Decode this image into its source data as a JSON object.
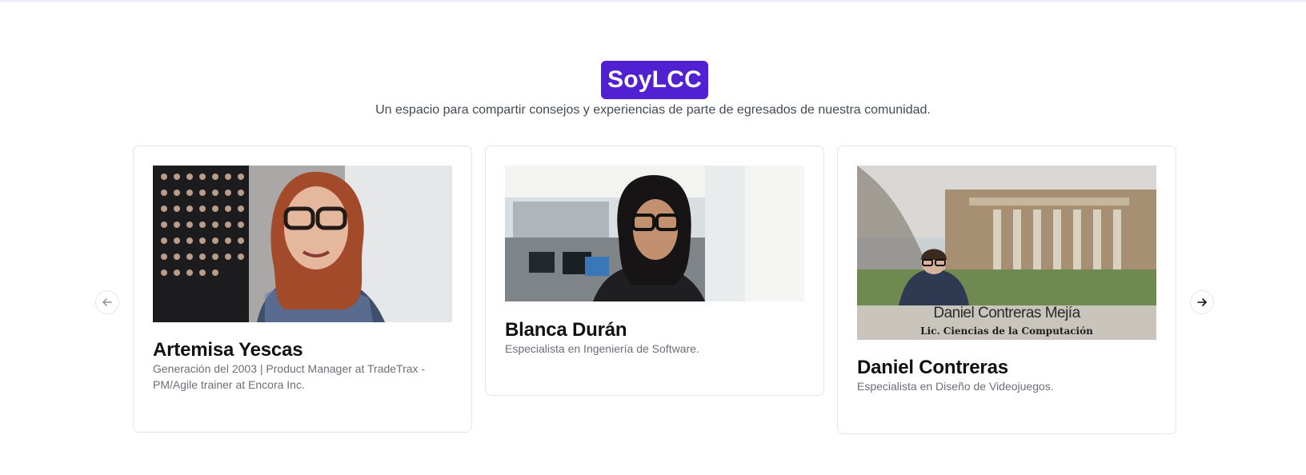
{
  "header": {
    "brand": "SoyLCC",
    "subtitle": "Un espacio para compartir consejos y experiencias de parte de egresados de nuestra comunidad."
  },
  "carousel": {
    "prev_icon": "arrow-left-icon",
    "next_icon": "arrow-right-icon",
    "cards": [
      {
        "name": "Artemisa Yescas",
        "description": "Generación del 2003 | Product Manager at TradeTrax - PM/Agile trainer at Encora Inc.",
        "photo_icon": "video-thumbnail"
      },
      {
        "name": "Blanca Durán",
        "description": "Especialista en Ingeniería de Software.",
        "photo_icon": "video-thumbnail"
      },
      {
        "name": "Daniel Contreras",
        "description": "Especialista en Diseño de Videojuegos.",
        "photo_icon": "video-thumbnail",
        "overlay_title": "Daniel Contreras Mejía",
        "overlay_subtitle": "Lic. Ciencias de la Computación"
      }
    ]
  },
  "colors": {
    "brand_bg": "#5120d0",
    "text_primary": "#111111",
    "text_muted": "#6b6f76"
  }
}
